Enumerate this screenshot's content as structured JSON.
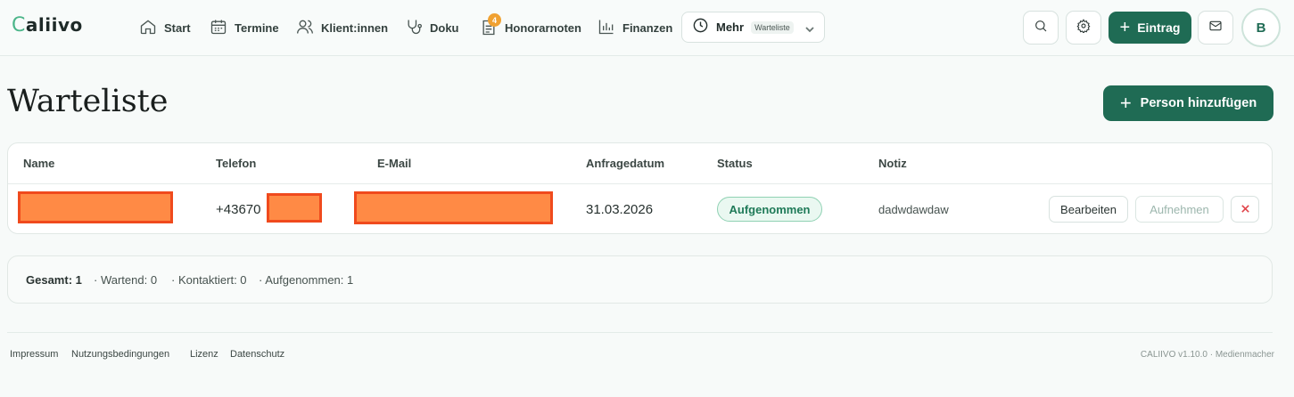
{
  "app": {
    "logo_c": "C",
    "logo_rest": "aliivo"
  },
  "nav": {
    "items": [
      {
        "label": "Start",
        "icon": "home-icon"
      },
      {
        "label": "Termine",
        "icon": "calendar-icon"
      },
      {
        "label": "Klient:innen",
        "icon": "users-icon"
      },
      {
        "label": "Doku",
        "icon": "stethoscope-icon"
      },
      {
        "label": "Honorarnoten",
        "icon": "invoice-icon",
        "badge": "4"
      },
      {
        "label": "Finanzen",
        "icon": "chart-icon"
      }
    ],
    "mehr": {
      "label": "Mehr",
      "sub": "Warteliste"
    },
    "eintrag_label": "Eintrag",
    "avatar": "B"
  },
  "page": {
    "title": "Warteliste",
    "add_button": "Person hinzufügen"
  },
  "table": {
    "headers": [
      "Name",
      "Telefon",
      "E-Mail",
      "Anfragedatum",
      "Status",
      "Notiz"
    ],
    "rows": [
      {
        "name": "",
        "phone_prefix": "+43670",
        "email": "",
        "date": "31.03.2026",
        "status": "Aufgenommen",
        "note": "dadwdawdaw",
        "edit_label": "Bearbeiten",
        "accept_label": "Aufnehmen"
      }
    ]
  },
  "summary": {
    "total": "Gesamt: 1",
    "waiting": "· Wartend: 0",
    "contacted": "· Kontaktiert: 0",
    "accepted": "· Aufgenommen: 1"
  },
  "footer": {
    "links": [
      "Impressum",
      "Nutzungsbedingungen",
      "Lizenz",
      "Datenschutz"
    ],
    "version": "CALIIVO v1.10.0 · Medienmacher"
  },
  "colors": {
    "accent": "#1f6b54",
    "status_green": "#1f7a58",
    "badge": "#f0a131",
    "redaction": "#ff8a45"
  }
}
